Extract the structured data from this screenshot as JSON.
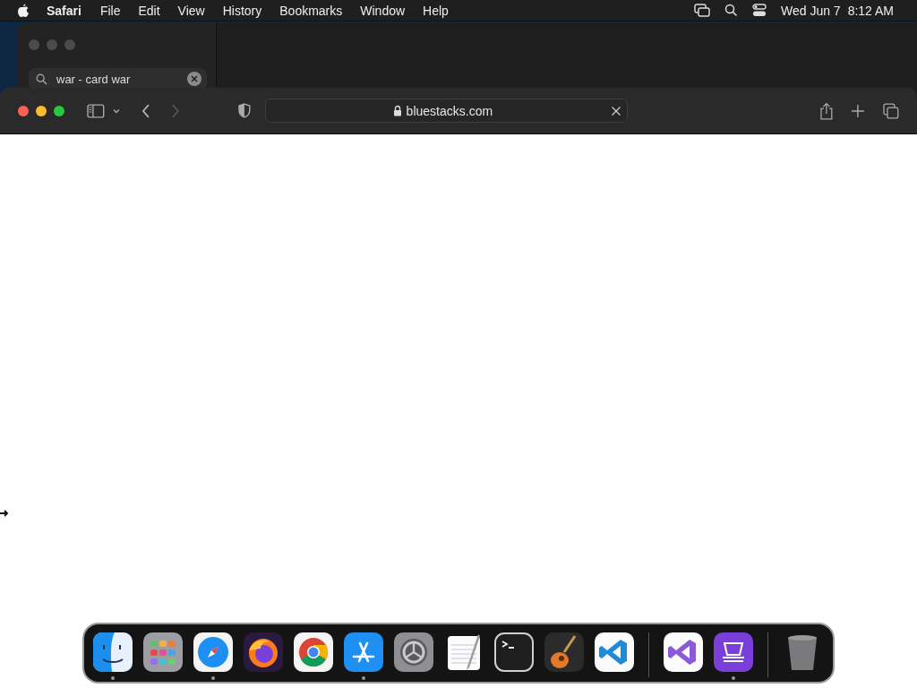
{
  "menu_bar": {
    "app_name": "Safari",
    "menus": [
      "File",
      "Edit",
      "View",
      "History",
      "Bookmarks",
      "Window",
      "Help"
    ],
    "clock": {
      "date": "Wed Jun 7",
      "time": "8:12 AM"
    }
  },
  "background_window": {
    "sidebar": {
      "search": {
        "value": "war - card war"
      }
    }
  },
  "browser": {
    "toolbar": {
      "back_disabled": false,
      "forward_disabled": true,
      "address": "bluestacks.com"
    }
  },
  "dock": {
    "sections": [
      [
        {
          "kind": "finder",
          "running": true
        },
        {
          "kind": "launchpad",
          "running": false
        },
        {
          "kind": "safari",
          "running": true
        },
        {
          "kind": "firefox",
          "running": false
        },
        {
          "kind": "chrome",
          "running": false
        },
        {
          "kind": "appstore",
          "running": true
        },
        {
          "kind": "settings",
          "running": false
        },
        {
          "kind": "textedit",
          "running": false
        },
        {
          "kind": "terminal",
          "running": false
        },
        {
          "kind": "garageband",
          "running": false
        },
        {
          "kind": "vscode",
          "running": false
        }
      ],
      [
        {
          "kind": "visualstudio",
          "running": false
        },
        {
          "kind": "configurator",
          "running": true
        }
      ],
      [
        {
          "kind": "trash",
          "running": false
        }
      ]
    ]
  }
}
